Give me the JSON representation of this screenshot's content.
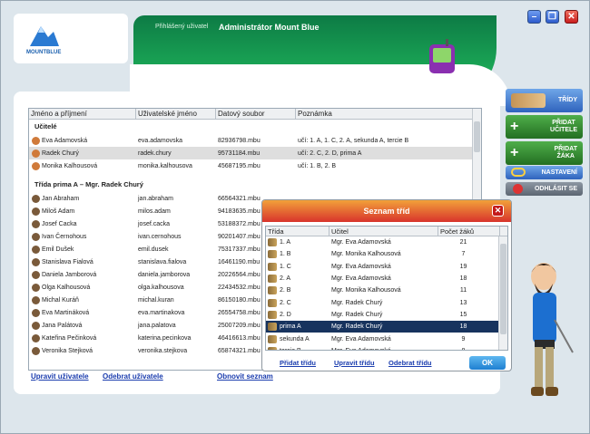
{
  "header": {
    "logo_text": "MOUNTBLUE",
    "logged_label": "Přihlášený uživatel",
    "logged_user": "Administrátor Mount Blue"
  },
  "window_controls": {
    "minimize": "–",
    "restore": "❐",
    "close": "✕"
  },
  "nav": [
    {
      "label": "TŘÍDY",
      "icon": "classes-icon"
    },
    {
      "label": "PŘIDAT\nUČITELE",
      "icon": "add-teacher-icon"
    },
    {
      "label": "PŘIDAT\nŽÁKA",
      "icon": "add-student-icon"
    },
    {
      "label": "NASTAVENÍ",
      "icon": "settings-icon"
    },
    {
      "label": "ODHLÁSIT SE",
      "icon": "logout-icon"
    }
  ],
  "table": {
    "columns": [
      "Jméno a příjmení",
      "Uživatelské jméno",
      "Datový soubor",
      "Poznámka"
    ],
    "groups": [
      {
        "title": "Učitelé",
        "rows": [
          {
            "name": "Eva Adamovská",
            "user": "eva.adamovska",
            "file": "82936798.mbu",
            "note": "učí: 1. A, 1. C, 2. A, sekunda A, tercie B"
          },
          {
            "name": "Radek Churý",
            "user": "radek.chury",
            "file": "95731184.mbu",
            "note": "učí: 2. C, 2. D, prima A",
            "selected": true
          },
          {
            "name": "Monika Kalhousová",
            "user": "monika.kalhousova",
            "file": "45687195.mbu",
            "note": "učí: 1. B, 2. B"
          }
        ]
      },
      {
        "title": "Třída prima A – Mgr. Radek Churý",
        "rows": [
          {
            "name": "Jan Abraham",
            "user": "jan.abraham",
            "file": "66564321.mbu",
            "note": ""
          },
          {
            "name": "Miloš Adam",
            "user": "milos.adam",
            "file": "94183635.mbu",
            "note": ""
          },
          {
            "name": "Josef Cacka",
            "user": "josef.cacka",
            "file": "53188372.mbu",
            "note": ""
          },
          {
            "name": "Ivan Černohous",
            "user": "ivan.cernohous",
            "file": "90201407.mbu",
            "note": ""
          },
          {
            "name": "Emil Dušek",
            "user": "emil.dusek",
            "file": "75317337.mbu",
            "note": ""
          },
          {
            "name": "Stanislava Fialová",
            "user": "stanislava.fialova",
            "file": "16461190.mbu",
            "note": ""
          },
          {
            "name": "Daniela Jamborová",
            "user": "daniela.jamborova",
            "file": "20226564.mbu",
            "note": ""
          },
          {
            "name": "Olga Kalhousová",
            "user": "olga.kalhousova",
            "file": "22434532.mbu",
            "note": ""
          },
          {
            "name": "Michal Kuráň",
            "user": "michal.kuran",
            "file": "86150180.mbu",
            "note": ""
          },
          {
            "name": "Eva Martináková",
            "user": "eva.martinakova",
            "file": "26554758.mbu",
            "note": ""
          },
          {
            "name": "Jana Palátová",
            "user": "jana.palatova",
            "file": "25007209.mbu",
            "note": ""
          },
          {
            "name": "Kateřina Pečinková",
            "user": "katerina.pecinkova",
            "file": "46416613.mbu",
            "note": ""
          },
          {
            "name": "Veronika Stejková",
            "user": "veronika.stejkova",
            "file": "65874321.mbu",
            "note": ""
          }
        ]
      }
    ]
  },
  "bottom_links": {
    "edit_user": "Upravit uživatele",
    "remove_user": "Odebrat uživatele",
    "refresh": "Obnovit seznam"
  },
  "dialog": {
    "title": "Seznam tříd",
    "close": "✕",
    "columns": [
      "Třída",
      "Učitel",
      "Počet žáků"
    ],
    "rows": [
      {
        "cls": "1. A",
        "teacher": "Mgr. Eva Adamovská",
        "count": "21"
      },
      {
        "cls": "1. B",
        "teacher": "Mgr. Monika Kalhousová",
        "count": "7"
      },
      {
        "cls": "1. C",
        "teacher": "Mgr. Eva Adamovská",
        "count": "19"
      },
      {
        "cls": "2. A",
        "teacher": "Mgr. Eva Adamovská",
        "count": "18"
      },
      {
        "cls": "2. B",
        "teacher": "Mgr. Monika Kalhousová",
        "count": "11"
      },
      {
        "cls": "2. C",
        "teacher": "Mgr. Radek Churý",
        "count": "13"
      },
      {
        "cls": "2. D",
        "teacher": "Mgr. Radek Churý",
        "count": "15"
      },
      {
        "cls": "prima A",
        "teacher": "Mgr. Radek Churý",
        "count": "18",
        "selected": true
      },
      {
        "cls": "sekunda A",
        "teacher": "Mgr. Eva Adamovská",
        "count": "9"
      },
      {
        "cls": "tercie B",
        "teacher": "Mgr. Eva Adamovská",
        "count": "8"
      }
    ],
    "add": "Přidat třídu",
    "edit": "Upravit třídu",
    "remove": "Odebrat třídu",
    "ok": "OK"
  },
  "colors": {
    "accent_green": "#1aa555",
    "header_red": "#d8342c",
    "selection": "#17335e"
  }
}
